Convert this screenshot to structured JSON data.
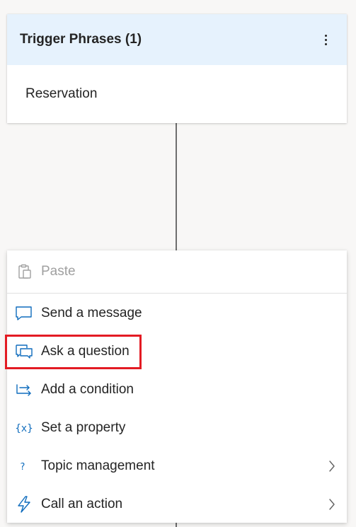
{
  "trigger": {
    "title": "Trigger Phrases (1)",
    "phrase": "Reservation",
    "more_icon": "more-vertical-icon"
  },
  "menu": {
    "items": [
      {
        "label": "Paste",
        "icon": "clipboard-paste-icon",
        "disabled": true
      },
      {
        "label": "Send a message",
        "icon": "chat-bubble-icon"
      },
      {
        "label": "Ask a question",
        "icon": "chat-question-icon",
        "highlighted": true
      },
      {
        "label": "Add a condition",
        "icon": "branch-arrow-icon"
      },
      {
        "label": "Set a property",
        "icon": "variable-braces-icon"
      },
      {
        "label": "Topic management",
        "icon": "question-mark-icon",
        "has_submenu": true
      },
      {
        "label": "Call an action",
        "icon": "lightning-bolt-icon",
        "has_submenu": true
      }
    ]
  },
  "colors": {
    "header_bg": "#e6f2fd",
    "icon_accent": "#0f6cbd",
    "highlight": "#e31b23",
    "canvas_bg": "#f8f7f6"
  }
}
